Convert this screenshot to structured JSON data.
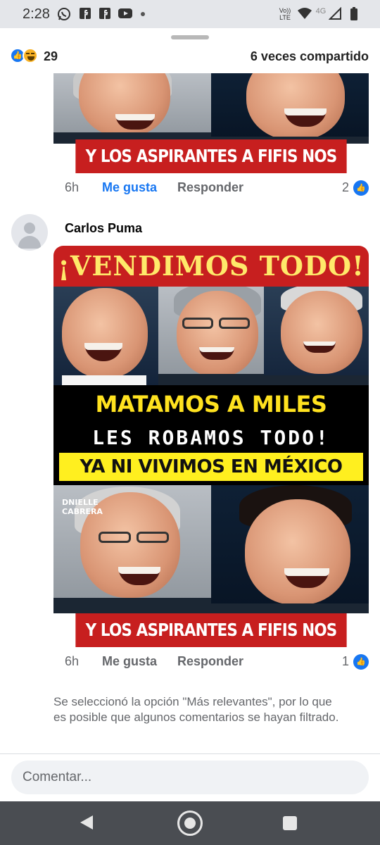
{
  "status_bar": {
    "time": "2:28",
    "icons": [
      "whatsapp-icon",
      "facebook-icon",
      "facebook-icon",
      "youtube-icon",
      "dot-icon",
      "volte-icon",
      "wifi-icon",
      "4g-icon",
      "signal-icon",
      "battery-icon"
    ],
    "network_label": "4G",
    "volte_label": "Vo)) LTE"
  },
  "post_summary": {
    "reaction_count": "29",
    "reactions": [
      "like",
      "haha"
    ],
    "shares_text": "6 veces compartido"
  },
  "comments": [
    {
      "time": "6h",
      "like_label": "Me gusta",
      "like_active": true,
      "reply_label": "Responder",
      "like_count": "2",
      "image": {
        "bottom_text": "Y LOS ASPIRANTES A FIFIS NOS DEFIENDEN"
      }
    },
    {
      "author": "Carlos Puma",
      "time": "6h",
      "like_label": "Me gusta",
      "like_active": false,
      "reply_label": "Responder",
      "like_count": "1",
      "image": {
        "title": "¡VENDIMOS TODO!",
        "line1": "MATAMOS A MILES",
        "line2": "LES ROBAMOS TODO!",
        "line3": "YA NI VIVIMOS EN MÉXICO",
        "watermark": "DNIELLE CABRERA",
        "bottom_text": "Y LOS ASPIRANTES A FIFIS NOS DEFIENDEN"
      }
    }
  ],
  "notice": "Se seleccionó la opción \"Más relevantes\", por lo que es posible que algunos comentarios se hayan filtrado.",
  "composer": {
    "placeholder": "Comentar..."
  },
  "nav_bar": {
    "buttons": [
      "back-icon",
      "home-icon",
      "recents-icon"
    ]
  },
  "colors": {
    "accent": "#1877f2",
    "meme_red": "#c71f1f",
    "meme_yellow": "#ffe21f",
    "secondary_text": "#65676b"
  }
}
